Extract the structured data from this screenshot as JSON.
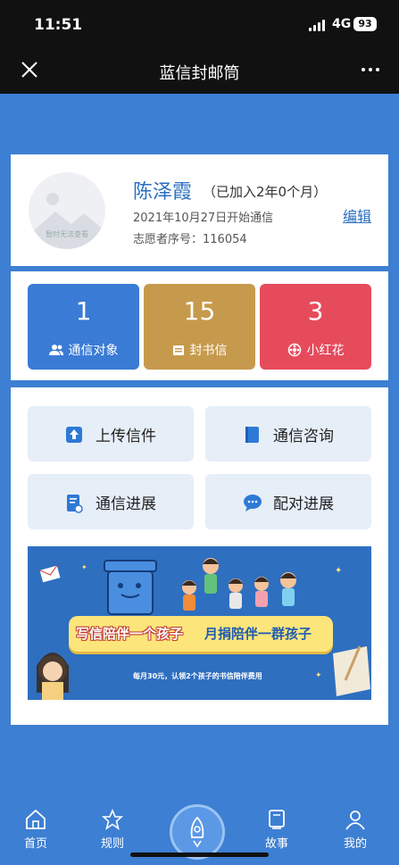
{
  "status": {
    "time": "11:51",
    "network": "4G",
    "battery": "93"
  },
  "nav": {
    "title": "蓝信封邮筒"
  },
  "profile": {
    "avatar_placeholder": "暂时无法查看",
    "name": "陈泽霞",
    "joined": "（已加入2年0个月）",
    "start_date": "2021年10月27日开始通信",
    "volunteer_no": "志愿者序号：116054",
    "edit_label": "编辑"
  },
  "stats": [
    {
      "value": "1",
      "label": "通信对象",
      "icon": "contacts-icon",
      "color": "#3a7bd5"
    },
    {
      "value": "15",
      "label": "封书信",
      "icon": "letter-icon",
      "color": "#c69a4c"
    },
    {
      "value": "3",
      "label": "小红花",
      "icon": "flower-icon",
      "color": "#e64b5c"
    }
  ],
  "actions": [
    {
      "label": "上传信件",
      "icon": "upload-icon"
    },
    {
      "label": "通信咨询",
      "icon": "book-icon"
    },
    {
      "label": "通信进展",
      "icon": "progress-doc-icon"
    },
    {
      "label": "配对进展",
      "icon": "chat-icon"
    }
  ],
  "banner": {
    "slogan_left": "写信陪伴一个孩子",
    "slogan_right": "月捐陪伴一群孩子",
    "subtitle": "每月30元，认领2个孩子的书信陪伴费用"
  },
  "tabs": [
    {
      "label": "首页",
      "icon": "home-icon"
    },
    {
      "label": "规则",
      "icon": "star-icon"
    },
    {
      "label": "故事",
      "icon": "story-icon"
    },
    {
      "label": "我的",
      "icon": "user-icon"
    }
  ],
  "colors": {
    "background": "#3d7fd3",
    "accent": "#2a6fbf"
  }
}
